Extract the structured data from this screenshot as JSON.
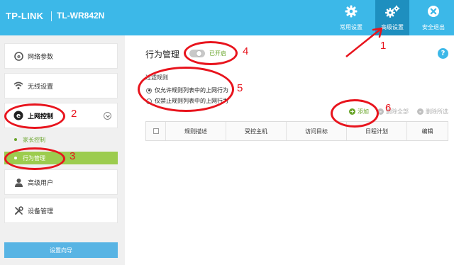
{
  "brand": {
    "logo": "TP-LINK",
    "model": "TL-WR842N"
  },
  "topnav": [
    {
      "label": "常用设置",
      "icon": "gear-icon"
    },
    {
      "label": "高级设置",
      "icon": "gears-icon",
      "active": true
    },
    {
      "label": "安全退出",
      "icon": "close-icon"
    }
  ],
  "sidebar": {
    "items": [
      {
        "label": "网络参数",
        "icon": "network-icon"
      },
      {
        "label": "无线设置",
        "icon": "wifi-icon"
      },
      {
        "label": "上网控制",
        "icon": "ie-icon",
        "expanded": true
      },
      {
        "label": "高级用户",
        "icon": "user-icon"
      },
      {
        "label": "设备管理",
        "icon": "tools-icon"
      }
    ],
    "sub_items": [
      {
        "label": "家长控制"
      },
      {
        "label": "行为管理",
        "active": true
      }
    ],
    "wizard": "设置向导"
  },
  "main": {
    "title": "行为管理",
    "toggle_text": "已开启",
    "help": "?",
    "filter_label": "过滤规则",
    "radios": [
      {
        "label": "仅允许规则列表中的上网行为",
        "checked": true
      },
      {
        "label": "仅禁止规则列表中的上网行为",
        "checked": false
      }
    ],
    "actions": {
      "add": "添加",
      "delete_all": "删除全部",
      "delete_selected": "删除所选"
    },
    "table_headers": [
      "规则描述",
      "受控主机",
      "访问目标",
      "日程计划",
      "编辑"
    ]
  },
  "annotations": [
    "1",
    "2",
    "3",
    "4",
    "5",
    "6"
  ],
  "colors": {
    "topbar": "#3cb8e8",
    "active_nav": "#1e8fbf",
    "green": "#6aa52b",
    "annotation_red": "#e8141d"
  }
}
